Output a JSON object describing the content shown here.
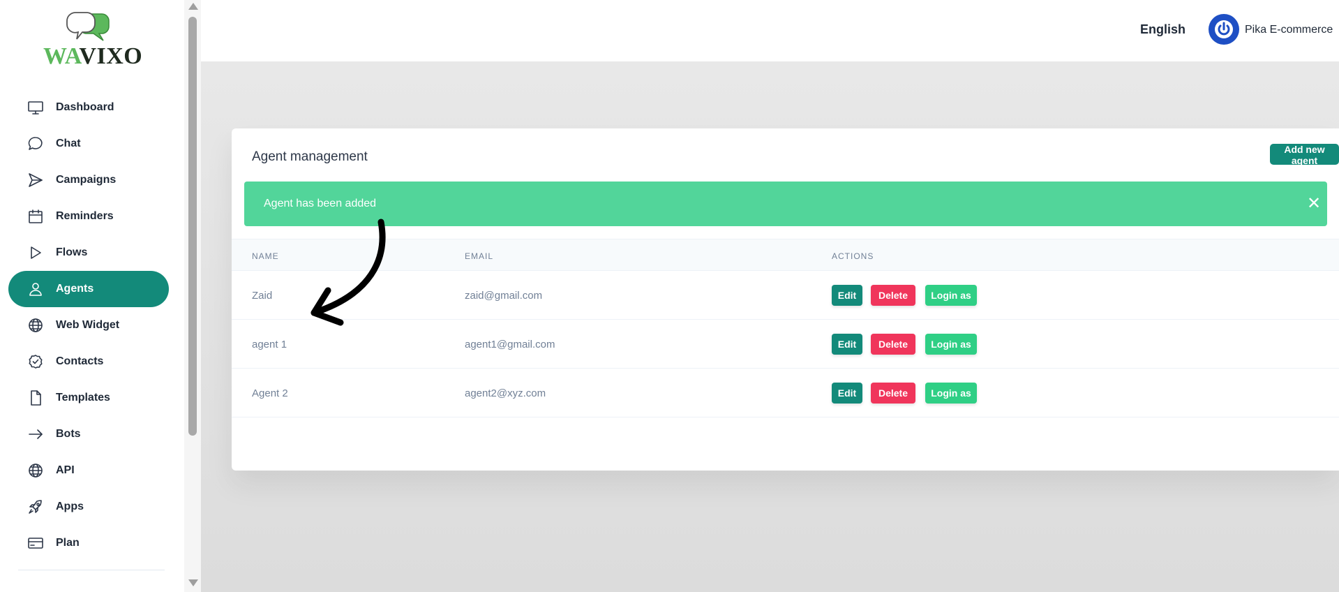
{
  "app": {
    "logo_wa": "WA",
    "logo_vixo": "VIXO"
  },
  "sidebar": {
    "items": [
      {
        "label": "Dashboard",
        "icon": "monitor-icon",
        "active": false
      },
      {
        "label": "Chat",
        "icon": "chat-bubble-icon",
        "active": false
      },
      {
        "label": "Campaigns",
        "icon": "send-icon",
        "active": false
      },
      {
        "label": "Reminders",
        "icon": "calendar-icon",
        "active": false
      },
      {
        "label": "Flows",
        "icon": "play-icon",
        "active": false
      },
      {
        "label": "Agents",
        "icon": "user-icon",
        "active": true
      },
      {
        "label": "Web Widget",
        "icon": "globe-icon",
        "active": false
      },
      {
        "label": "Contacts",
        "icon": "check-circle-icon",
        "active": false
      },
      {
        "label": "Templates",
        "icon": "document-icon",
        "active": false
      },
      {
        "label": "Bots",
        "icon": "arrow-right-icon",
        "active": false
      },
      {
        "label": "API",
        "icon": "globe-icon",
        "active": false
      },
      {
        "label": "Apps",
        "icon": "rocket-icon",
        "active": false
      },
      {
        "label": "Plan",
        "icon": "credit-card-icon",
        "active": false
      }
    ]
  },
  "header": {
    "language": "English",
    "org_name": "Pika E-commerce",
    "org_avatar_icon": "power-icon"
  },
  "main": {
    "title": "Agent management",
    "add_button": "Add new agent",
    "alert": {
      "message": "Agent has been added",
      "close_icon": "close-icon"
    },
    "table": {
      "columns": [
        "NAME",
        "EMAIL",
        "ACTIONS"
      ],
      "rows": [
        {
          "name": "Zaid",
          "email": "zaid@gmail.com"
        },
        {
          "name": "agent 1",
          "email": "agent1@gmail.com"
        },
        {
          "name": "Agent 2",
          "email": "agent2@xyz.com"
        }
      ],
      "actions": {
        "edit": "Edit",
        "delete": "Delete",
        "login": "Login as"
      }
    }
  },
  "colors": {
    "primary": "#138a7a",
    "alert_bg": "#52d59a",
    "delete": "#f0355b",
    "login": "#2fcf85",
    "avatar": "#1e4fc4"
  }
}
